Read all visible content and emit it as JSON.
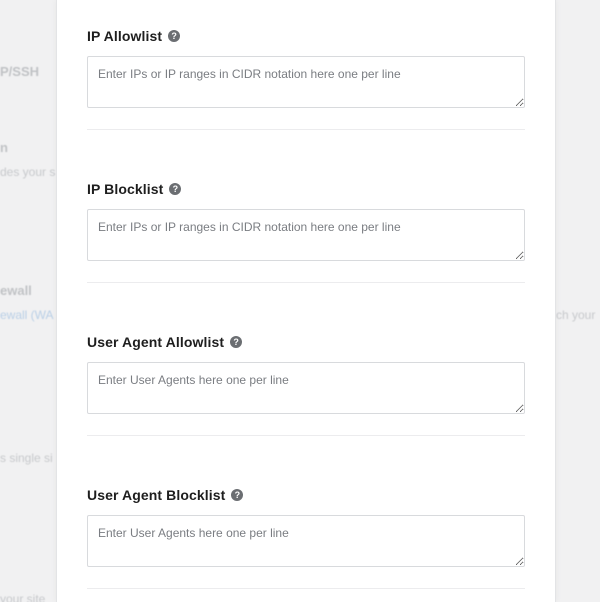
{
  "background": {
    "fragments": [
      {
        "text": "P/SSH",
        "style": "bold"
      },
      {
        "text": "n",
        "style": "bold"
      },
      {
        "text": "des your s",
        "style": "plain"
      },
      {
        "text": "ewall",
        "style": "bold"
      },
      {
        "text": "ewall (WA",
        "style": "link"
      },
      {
        "text": "ch your",
        "style": "plain"
      },
      {
        "text": "s single si",
        "style": "plain"
      },
      {
        "text": "your site",
        "style": "plain"
      }
    ]
  },
  "sections": [
    {
      "title": "IP Allowlist",
      "help": "?",
      "placeholder": "Enter IPs or IP ranges in CIDR notation here one per line"
    },
    {
      "title": "IP Blocklist",
      "help": "?",
      "placeholder": "Enter IPs or IP ranges in CIDR notation here one per line"
    },
    {
      "title": "User Agent Allowlist",
      "help": "?",
      "placeholder": "Enter User Agents here one per line"
    },
    {
      "title": "User Agent Blocklist",
      "help": "?",
      "placeholder": "Enter User Agents here one per line"
    }
  ],
  "colors": {
    "panel": "#ffffff",
    "page_background": "#f1f1f2",
    "help_icon": "#6b6e72"
  }
}
